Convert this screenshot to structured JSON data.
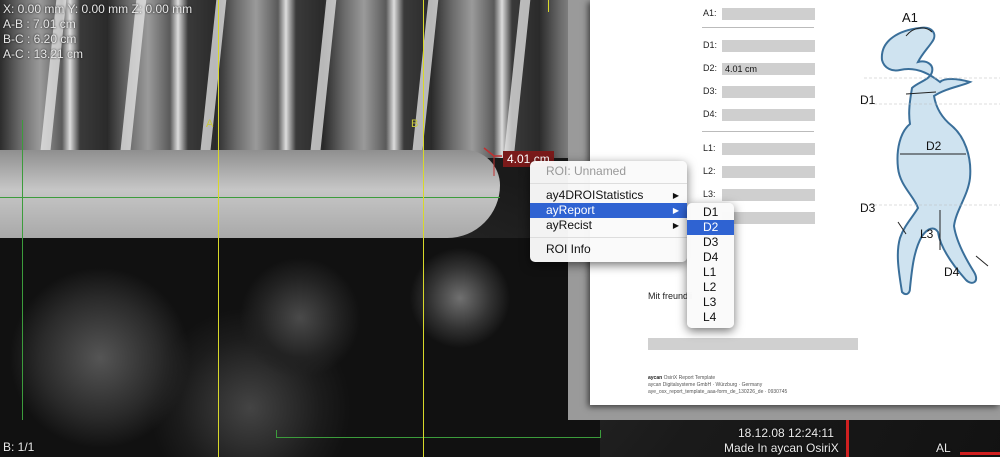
{
  "viewer": {
    "coords": "X: 0.00 mm Y: 0.00 mm Z: 0.00 mm",
    "ab": "A-B : 7.01 cm",
    "bc": "B-C : 6.20 cm",
    "ac": "A-C : 13.21 cm",
    "line_a": "A",
    "line_b": "B",
    "measurement": "4.01 cm",
    "series": "B: 1/1",
    "datetime": "18.12.08 12:24:11",
    "credit": "Made In aycan OsiriX",
    "orientation": "AL"
  },
  "context_menu": {
    "header": "ROI: Unnamed",
    "items": [
      {
        "label": "ay4DROIStatistics"
      },
      {
        "label": "ayReport"
      },
      {
        "label": "ayRecist"
      },
      {
        "label": "ROI Info"
      }
    ]
  },
  "submenu": {
    "items": [
      "D1",
      "D2",
      "D3",
      "D4",
      "L1",
      "L2",
      "L3",
      "L4"
    ],
    "selected": "D2"
  },
  "report": {
    "fields": [
      {
        "label": "A1:",
        "value": ""
      },
      {
        "label": "D1:",
        "value": ""
      },
      {
        "label": "D2:",
        "value": "4.01 cm"
      },
      {
        "label": "D3:",
        "value": ""
      },
      {
        "label": "D4:",
        "value": ""
      },
      {
        "label": "L1:",
        "value": ""
      },
      {
        "label": "L2:",
        "value": ""
      },
      {
        "label": "L3:",
        "value": ""
      }
    ],
    "greeting": "Mit freundli",
    "fine_brand": "aycan",
    "fine_title": "OsiriX Report Template",
    "fine_company": "aycan Digitalsysteme GmbH · Würzburg · Germany",
    "fine_file": "aye_osx_report_template_aaa-form_de_130226_de · 0930745"
  },
  "diagram": {
    "labels": [
      "A1",
      "D1",
      "D2",
      "D3",
      "L3",
      "D4"
    ]
  },
  "colors": {
    "menu_highlight": "#2f63d2",
    "guide_line": "#d8d82a",
    "measure_label": "#7a1a1a",
    "diagram_fill": "#cfe3f0",
    "diagram_stroke": "#3a6f9a"
  }
}
